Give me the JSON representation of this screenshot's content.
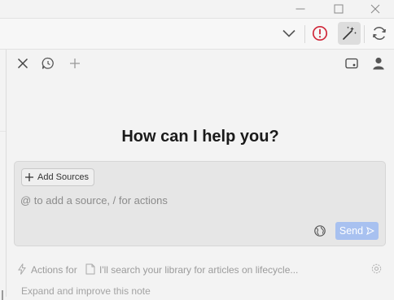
{
  "window": {
    "controls": [
      "minimize-icon",
      "maximize-icon",
      "close-icon"
    ]
  },
  "toolbar": {
    "icons": [
      "chevron-down-icon",
      "alert-circle-icon",
      "magic-wand-icon",
      "sync-icon"
    ],
    "colors": {
      "alert": "#d0283a",
      "active_bg": "#dddddd"
    }
  },
  "panel": {
    "header_icons_left": [
      "close-icon",
      "chat-history-icon",
      "new-chat-icon"
    ],
    "header_icons_right": [
      "layout-icon",
      "user-icon"
    ],
    "heading": "How can I help you?",
    "composer": {
      "add_sources_label": "Add Sources",
      "placeholder": "@ to add a source, / for actions",
      "send_label": "Send",
      "send_color": "#a8c1f0"
    },
    "actions_row": {
      "label": "Actions for",
      "suggestion": "I'll search your library for articles on lifecycle..."
    },
    "second_suggestion": "Expand and improve this note"
  }
}
